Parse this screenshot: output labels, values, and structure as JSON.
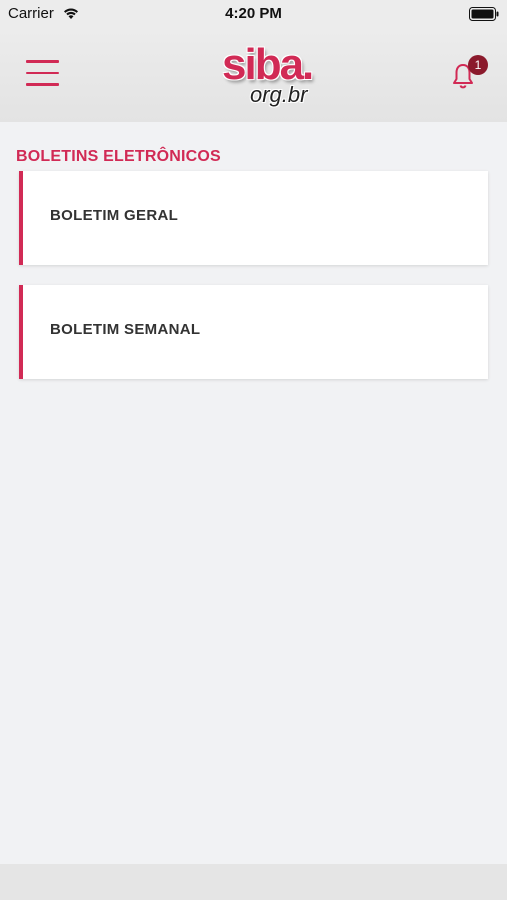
{
  "status_bar": {
    "carrier": "Carrier",
    "time": "4:20 PM"
  },
  "header": {
    "logo_main": "siba.",
    "logo_sub": "org.br",
    "notification_count": "1",
    "accent_color": "#d12a55",
    "badge_color": "#8b1a2c",
    "icons": [
      "menu-icon",
      "bell-icon"
    ]
  },
  "main": {
    "section_title": "BOLETINS ELETRÔNICOS",
    "items": [
      {
        "label": "BOLETIM GERAL"
      },
      {
        "label": "BOLETIM SEMANAL"
      }
    ]
  }
}
